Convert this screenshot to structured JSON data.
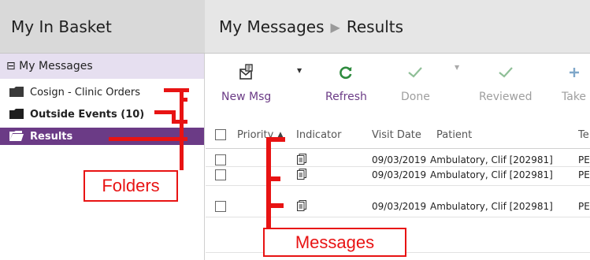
{
  "header": {
    "basket_title": "My In Basket",
    "messages_title": "My Messages",
    "breadcrumb_sep": "▶",
    "results_title": "Results"
  },
  "sidebar": {
    "root_label": "⊟ My Messages",
    "folders": [
      {
        "label": "Cosign - Clinic Orders",
        "bold": false,
        "selected": false
      },
      {
        "label": "Outside Events (10)",
        "bold": true,
        "selected": false
      },
      {
        "label": "Results",
        "bold": true,
        "selected": true
      }
    ]
  },
  "toolbar": {
    "new_msg": "New Msg",
    "refresh": "Refresh",
    "done": "Done",
    "reviewed": "Reviewed",
    "take": "Take"
  },
  "columns": {
    "priority": "Priority",
    "sort_arrow": "▲",
    "indicator": "Indicator",
    "visit_date": "Visit Date",
    "patient": "Patient",
    "te": "Te"
  },
  "rows": [
    {
      "visit_date": "09/03/2019",
      "patient": "Ambulatory, Clif [202981]",
      "te": "PE"
    },
    {
      "visit_date": "09/03/2019",
      "patient": "Ambulatory, Clif [202981]",
      "te": "PE"
    },
    {
      "visit_date": "09/03/2019",
      "patient": "Ambulatory, Clif [202981]",
      "te": "PE"
    }
  ],
  "annotations": {
    "folders": "Folders",
    "messages": "Messages"
  },
  "colors": {
    "accent_purple": "#6b3b86",
    "selection_bg": "#e6dff0",
    "annotation_red": "#e81313",
    "refresh_green": "#2e8b3e"
  }
}
